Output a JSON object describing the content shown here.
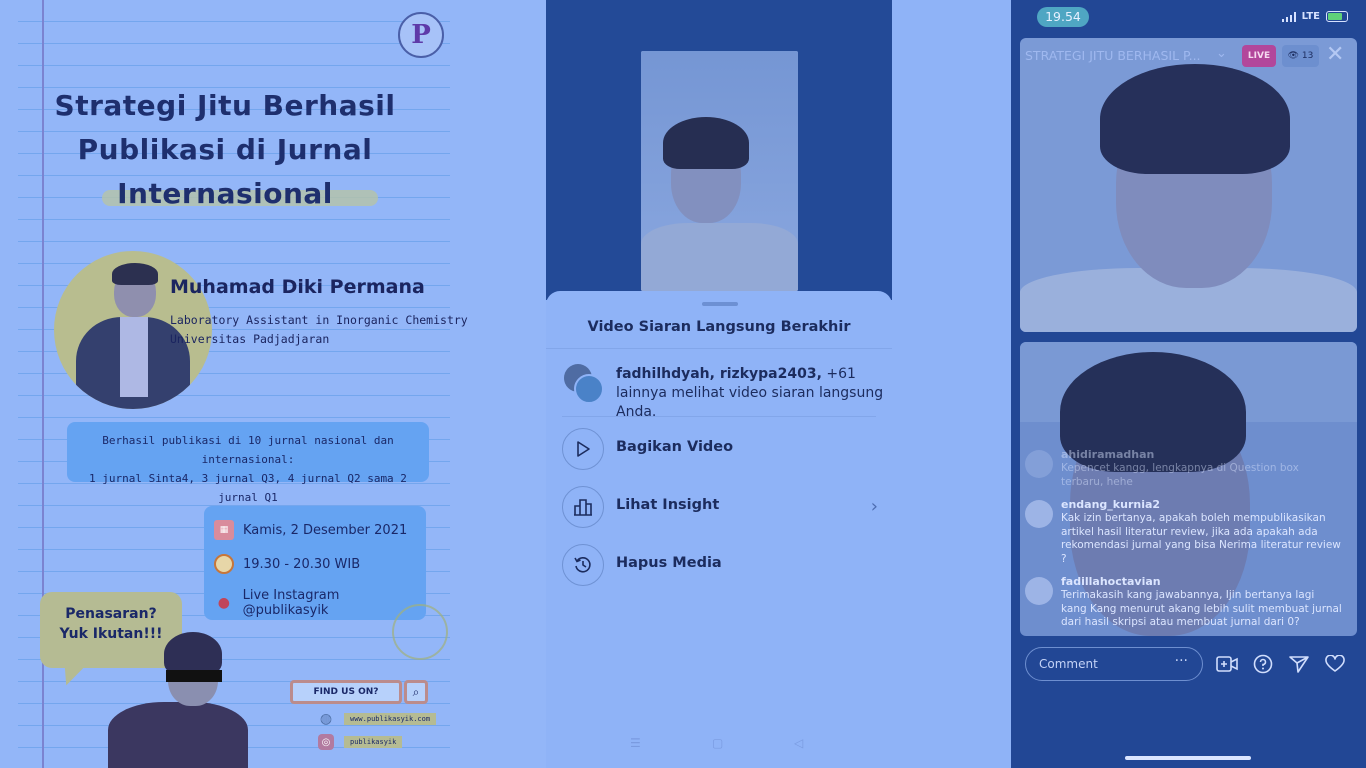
{
  "poster": {
    "logo_letter": "P",
    "title": "Strategi Jitu Berhasil Publikasi di Jurnal Internasional",
    "speaker_name": "Muhamad Diki Permana",
    "speaker_role_line1": "Laboratory Assistant in Inorganic Chemistry",
    "speaker_role_line2": "Universitas Padjadjaran",
    "achievement_line1": "Berhasil publikasi di 10 jurnal nasional dan internasional:",
    "achievement_line2": "1 jurnal Sinta4, 3 jurnal Q3, 4 jurnal Q2 sama 2 jurnal Q1",
    "date": "Kamis, 2 Desember 2021",
    "time": "19.30 - 20.30 WIB",
    "location": "Live Instagram @publikasyik",
    "bubble_line1": "Penasaran?",
    "bubble_line2": "Yuk Ikutan!!!",
    "find_us": "FIND US ON?",
    "website": "www.publikasyik.com",
    "instagram": "publikasyik",
    "icons": {
      "calendar": "calendar-icon",
      "clock": "clock-icon",
      "pin": "location-pin-icon",
      "search": "search-icon",
      "globe": "globe-icon",
      "instagram": "instagram-icon"
    }
  },
  "middle": {
    "sheet_title": "Video Siaran Langsung Berakhir",
    "viewers_names": "fadhilhdyah, rizkypa2403,",
    "viewers_rest": " +61 lainnya melihat video siaran langsung Anda.",
    "actions": [
      {
        "label": "Bagikan Video",
        "icon": "play-icon"
      },
      {
        "label": "Lihat Insight",
        "icon": "bar-chart-icon"
      },
      {
        "label": "Hapus Media",
        "icon": "history-icon"
      }
    ]
  },
  "phone": {
    "time": "19.54",
    "network": "LTE",
    "live_title": "STRATEGI JITU BERHASIL P...",
    "live_badge": "LIVE",
    "viewer_count": "13",
    "comments": [
      {
        "user": "ahidiramadhan",
        "text": "Kepencet kangg, lengkapnya di Question box terbaru, hehe",
        "faded": true
      },
      {
        "user": "endang_kurnia2",
        "text": "Kak izin bertanya, apakah boleh mempublikasikan artikel hasil literatur review, jika ada apakah ada rekomendasi jurnal yang bisa Nerima literatur review ?",
        "faded": false
      },
      {
        "user": "fadillahoctavian",
        "text": "Terimakasih kang jawabannya, Ijin bertanya lagi kang Kang menurut akang lebih sulit membuat jurnal dari hasil skripsi atau membuat jurnal dari 0?",
        "faded": false
      }
    ],
    "comment_placeholder": "Comment",
    "colors": {
      "live_badge": "#b2479b",
      "time_pill": "#4fa6c3",
      "panel": "#224795"
    }
  }
}
